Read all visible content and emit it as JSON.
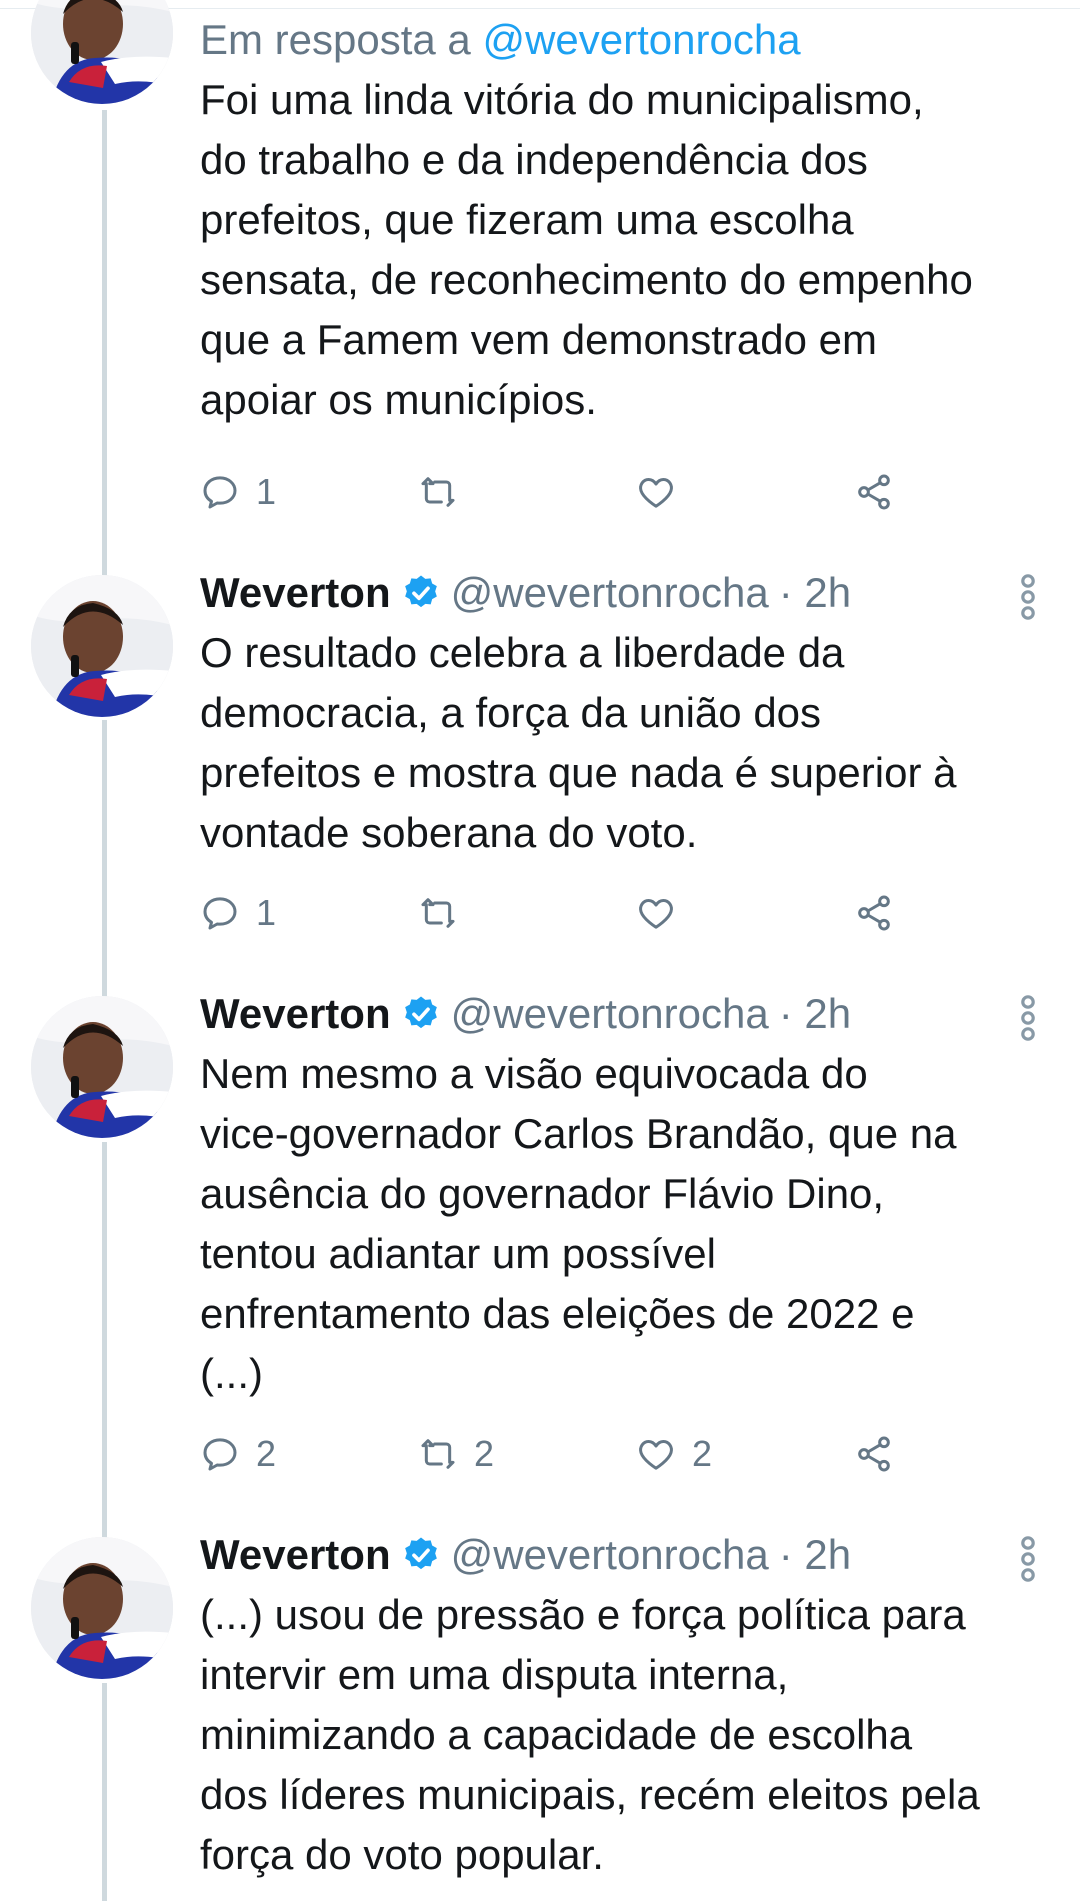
{
  "reply_context": {
    "prefix": "Em resposta a ",
    "handle_link": "@wevertonrocha"
  },
  "tweets": [
    {
      "name": "",
      "handle": "",
      "time": "",
      "text": "Foi uma linda vitória do municipalismo,\ndo trabalho e da independência dos\nprefeitos, que fizeram uma escolha\nsensata, de reconhecimento do empenho\nque a Famem vem demonstrado em\napoiar os municípios.",
      "replies": "1",
      "retweets": "",
      "likes": ""
    },
    {
      "name": "Weverton",
      "handle": "@wevertonrocha",
      "time": "· 2h",
      "text": "O resultado celebra a liberdade da\ndemocracia, a força da união dos\nprefeitos e mostra que nada é superior à\nvontade soberana do voto.",
      "replies": "1",
      "retweets": "",
      "likes": ""
    },
    {
      "name": "Weverton",
      "handle": "@wevertonrocha",
      "time": "· 2h",
      "text": "Nem mesmo a visão equivocada do\nvice-governador Carlos Brandão, que na\nausência do governador Flávio Dino,\ntentou adiantar um possível\nenfrentamento das eleições de 2022 e\n(...)",
      "replies": "2",
      "retweets": "2",
      "likes": "2"
    },
    {
      "name": "Weverton",
      "handle": "@wevertonrocha",
      "time": "· 2h",
      "text": "(...) usou de pressão e força política para\nintervir em uma disputa interna,\nminimizando a capacidade de escolha\ndos líderes municipais, recém eleitos pela\nforça do voto popular.",
      "replies": "",
      "retweets": "",
      "likes": ""
    }
  ],
  "icons": {
    "reply": "reply-icon",
    "retweet": "retweet-icon",
    "like": "like-icon",
    "share": "share-icon",
    "verified": "verified-badge-icon",
    "more": "more-options-icon"
  },
  "colors": {
    "text": "#14171a",
    "muted": "#657786",
    "link": "#1da1f2",
    "verified": "#1da1f2",
    "thread_line": "#cfd9de"
  }
}
